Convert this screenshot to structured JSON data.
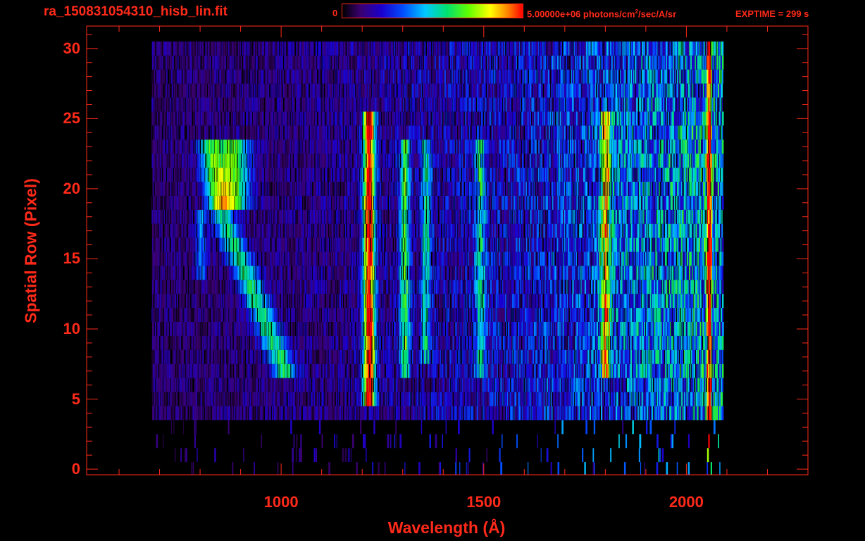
{
  "header": {
    "filename": "ra_150831054310_hisb_lin.fit",
    "colorbar_min": "0",
    "colorbar_max_prefix": "5.00000e+06 photons/cm",
    "colorbar_max_exp": "2",
    "colorbar_max_suffix": "/sec/A/sr",
    "exptime": "EXPTIME = 299 s"
  },
  "colors": {
    "axis": "#ff2a1a",
    "background": "#000000"
  },
  "chart_data": {
    "type": "heatmap",
    "title": "ra_150831054310_hisb_lin.fit",
    "xlabel": "Wavelength (Å)",
    "ylabel": "Spatial Row (Pixel)",
    "xlim": [
      520,
      2300
    ],
    "ylim": [
      -0.4,
      31.6
    ],
    "xticks": [
      1000,
      1500,
      2000
    ],
    "yticks": [
      0,
      5,
      10,
      15,
      20,
      25,
      30
    ],
    "colorscale": {
      "min": 0,
      "max": 5000000,
      "units": "photons/cm^2/sec/A/sr"
    },
    "emission_features": [
      {
        "name": "diagonal arc",
        "x_range": [
          790,
          1040
        ],
        "rows": [
          7,
          23
        ]
      },
      {
        "name": "bright line",
        "x": 1216,
        "rows": [
          5,
          25
        ],
        "relative_intensity": 1.0
      },
      {
        "name": "line",
        "x": 1304,
        "rows": [
          7,
          23
        ],
        "relative_intensity": 0.5
      },
      {
        "name": "line",
        "x": 1356,
        "rows": [
          8,
          23
        ],
        "relative_intensity": 0.35
      },
      {
        "name": "line",
        "x": 1490,
        "rows": [
          7,
          23
        ],
        "relative_intensity": 0.35
      },
      {
        "name": "line",
        "x": 1800,
        "rows": [
          7,
          25
        ],
        "relative_intensity": 0.55
      },
      {
        "name": "edge",
        "x": 2055,
        "rows": [
          1,
          30
        ],
        "relative_intensity": 0.8
      }
    ],
    "data_extent": {
      "x_range": [
        680,
        2090
      ],
      "rows": [
        0,
        30
      ]
    }
  }
}
